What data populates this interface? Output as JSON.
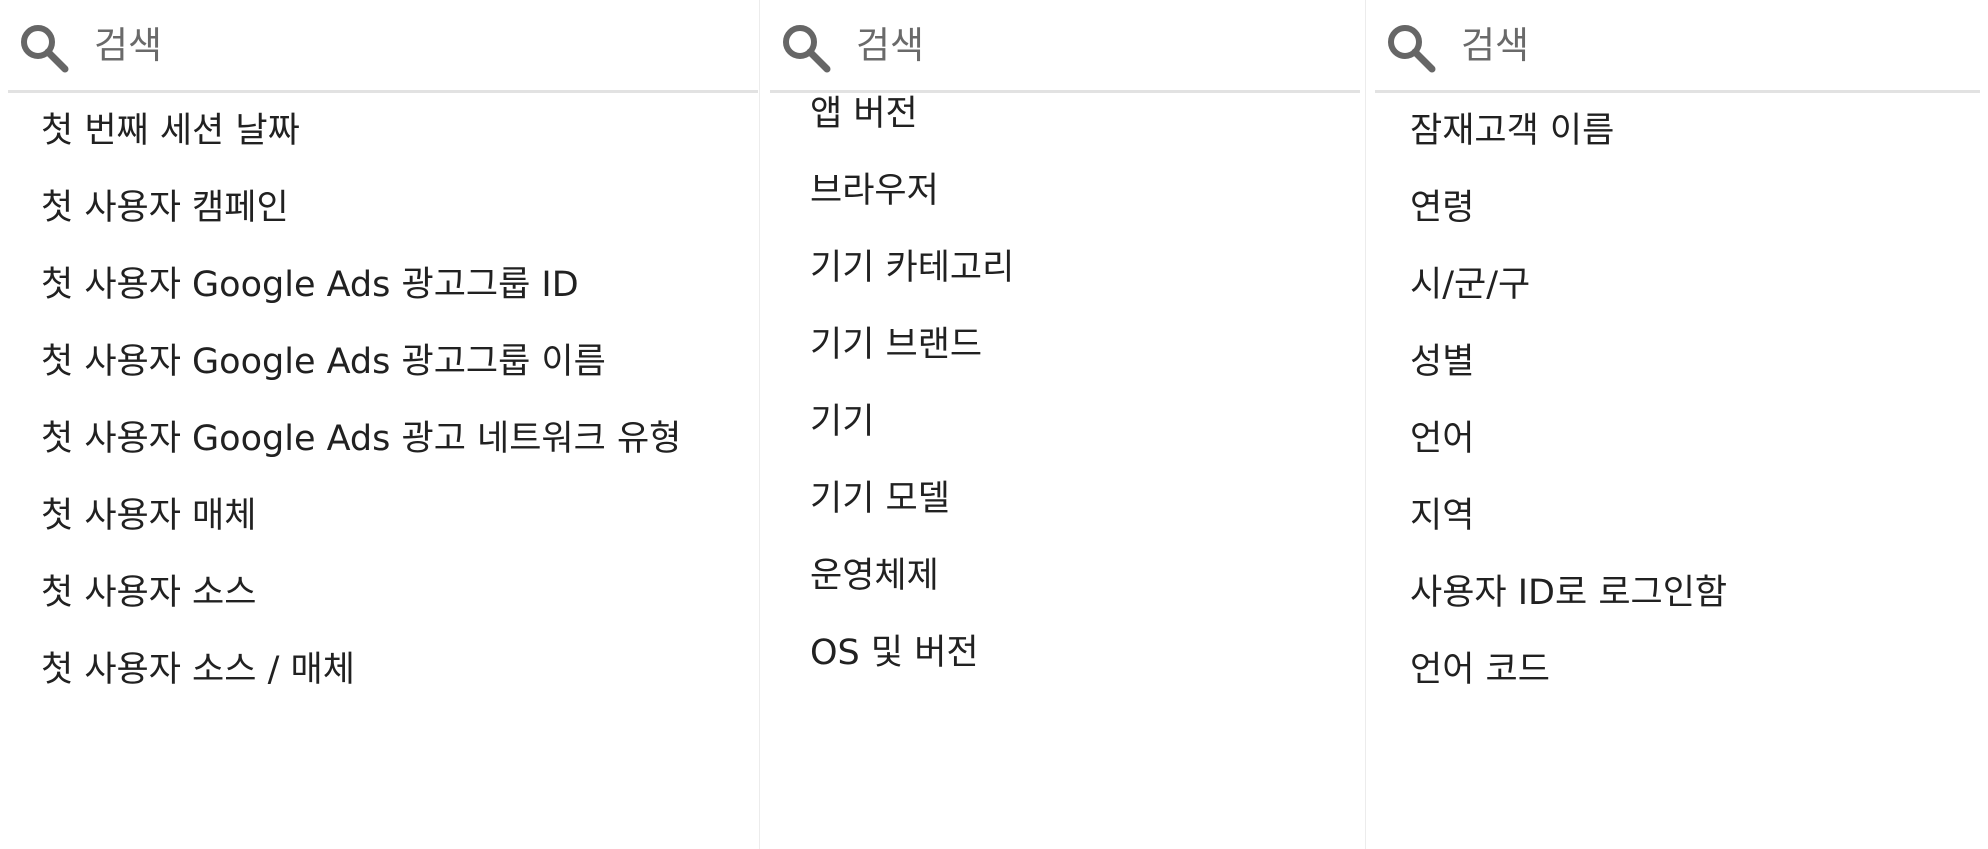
{
  "panels": [
    {
      "search": {
        "placeholder": "검색",
        "value": ""
      },
      "items": [
        "첫 번째 세션 날짜",
        "첫 사용자 캠페인",
        "첫 사용자 Google Ads 광고그룹 ID",
        "첫 사용자 Google Ads 광고그룹 이름",
        "첫 사용자 Google Ads 광고 네트워크 유형",
        "첫 사용자 매체",
        "첫 사용자 소스",
        "첫 사용자 소스 / 매체"
      ]
    },
    {
      "search": {
        "placeholder": "검색",
        "value": ""
      },
      "items": [
        "앱 버전",
        "브라우저",
        "기기 카테고리",
        "기기 브랜드",
        "기기",
        "기기 모델",
        "운영체제",
        "OS 및 버전"
      ]
    },
    {
      "search": {
        "placeholder": "검색",
        "value": ""
      },
      "items": [
        "잠재고객 이름",
        "연령",
        "시/군/구",
        "성별",
        "언어",
        "지역",
        "사용자 ID로 로그인함",
        "언어 코드"
      ]
    }
  ],
  "icons": {
    "search": "search-icon"
  },
  "colors": {
    "divider": "#e2e2e2",
    "text": "#212121",
    "placeholder": "#6a6a6a",
    "icon": "#666666"
  }
}
